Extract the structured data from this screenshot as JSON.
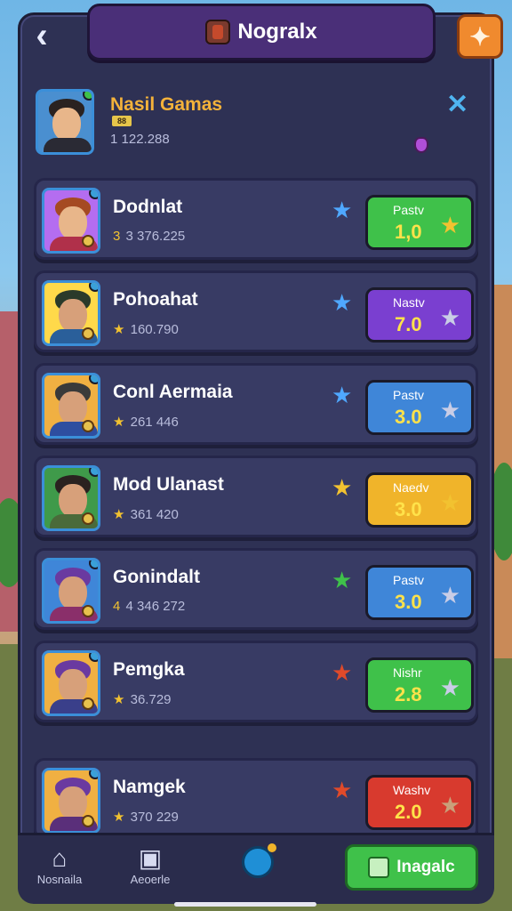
{
  "header": {
    "title": "Nogralx",
    "back_icon": "back-chevron-icon",
    "settings_icon": "settings-badge-icon"
  },
  "profile": {
    "name": "Nasil Gamas",
    "score": "1 122.288",
    "tag": "88"
  },
  "players": [
    {
      "name": "Dodnlat",
      "score": "3 376.225",
      "score_prefix": "3",
      "star_color": "#4fa8ff",
      "button_label": "Pastv",
      "button_value": "1,0",
      "button_color": "#3fc14a",
      "button_star_color": "#f2c230",
      "hair": "#a54a22",
      "skin": "#e8b68a",
      "body": "#b0304a",
      "frame": "#b46df0"
    },
    {
      "name": "Pohoahat",
      "score": "160.790",
      "score_prefix": "★",
      "star_color": "#4fa8ff",
      "button_label": "Nastv",
      "button_value": "7.0",
      "button_color": "#7a3fd0",
      "button_star_color": "#c9cde6",
      "hair": "#2a3a2a",
      "skin": "#d7a07a",
      "body": "#2a5f9a",
      "frame": "#ffd94a"
    },
    {
      "name": "Conl Aermaia",
      "score": "261 446",
      "score_prefix": "★",
      "star_color": "#4fa8ff",
      "button_label": "Pastv",
      "button_value": "3.0",
      "button_color": "#3f86d8",
      "button_star_color": "#c9cde6",
      "hair": "#3a3a3a",
      "skin": "#d7a07a",
      "body": "#2e4ea0",
      "frame": "#f0b042"
    },
    {
      "name": "Mod Ulanast",
      "score": "361 420",
      "score_prefix": "★",
      "star_color": "#f2c230",
      "button_label": "Naedv",
      "button_value": "3.0",
      "button_color": "#f0b42a",
      "button_star_color": "#f2c230",
      "hair": "#2a2220",
      "skin": "#d7a07a",
      "body": "#4a6a3a",
      "frame": "#3f9a4a"
    },
    {
      "name": "Gonindalt",
      "score": "4 346 272",
      "score_prefix": "4",
      "star_color": "#3fc14a",
      "button_label": "Pastv",
      "button_value": "3.0",
      "button_color": "#3f86d8",
      "button_star_color": "#c9cde6",
      "hair": "#6a3aa0",
      "skin": "#d7a07a",
      "body": "#8a2f6a",
      "frame": "#3f86d8"
    },
    {
      "name": "Pemgka",
      "score": "36.729",
      "score_prefix": "★",
      "star_color": "#e04a2a",
      "button_label": "Nishr",
      "button_value": "2.8",
      "button_color": "#3fc14a",
      "button_star_color": "#c9cde6",
      "hair": "#6a3aa0",
      "skin": "#d7a07a",
      "body": "#3a3f8a",
      "frame": "#f0b042"
    },
    {
      "name": "Namgek",
      "score": "370 229",
      "score_prefix": "★",
      "star_color": "#e04a2a",
      "button_label": "Washv",
      "button_value": "2.0",
      "button_color": "#d83a2e",
      "button_star_color": "#c9a07a",
      "hair": "#6a3aa0",
      "skin": "#d7a07a",
      "body": "#5a2f7a",
      "frame": "#f0b042"
    }
  ],
  "nav": {
    "home_label": "Nosnaila",
    "second_label": "Aeoerle",
    "cta_label": "Inagalc"
  }
}
